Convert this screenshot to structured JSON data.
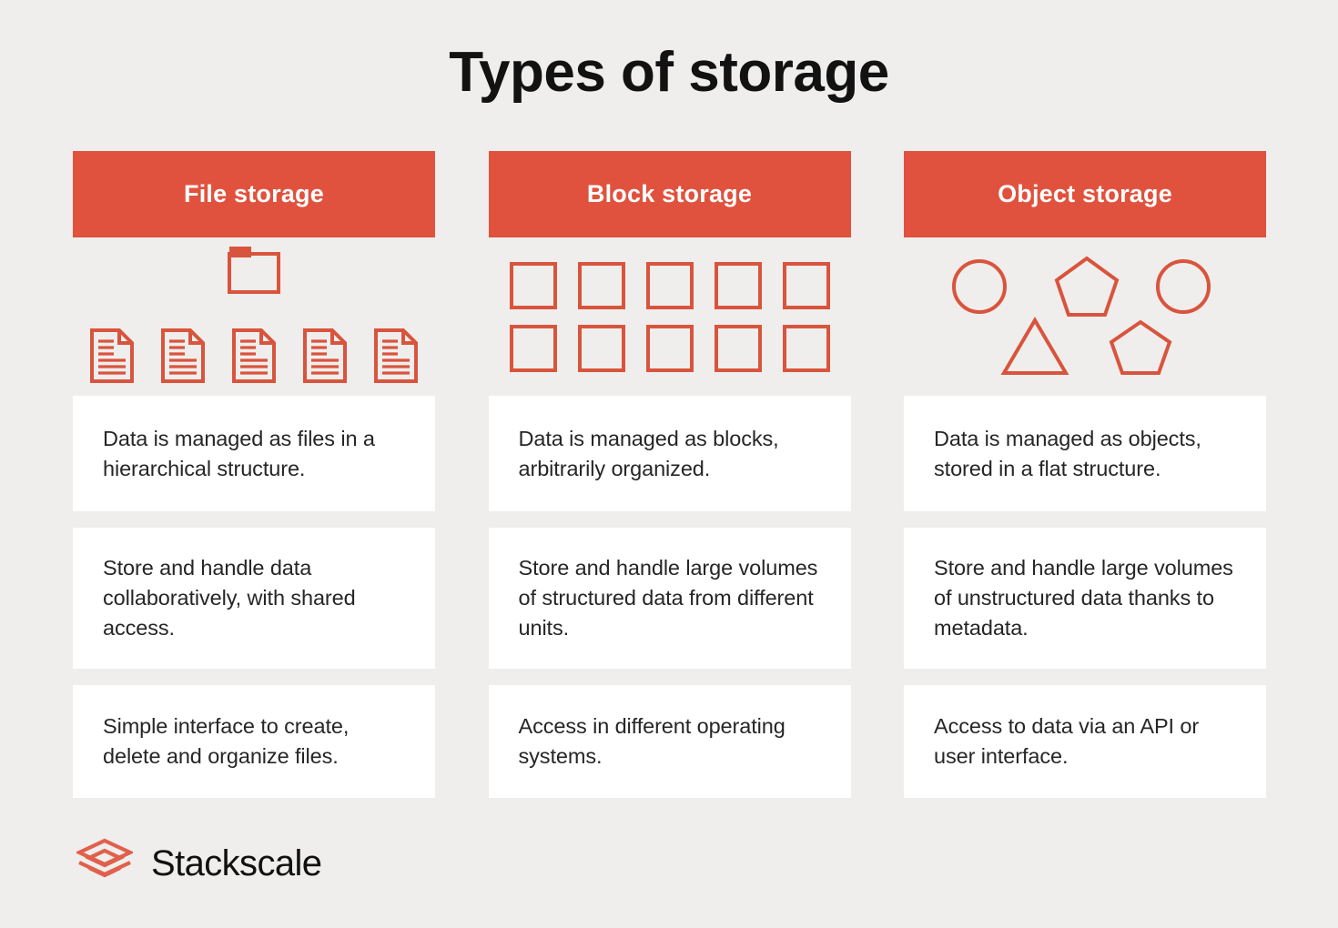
{
  "page": {
    "title": "Types of storage",
    "background_color": "#efeeec",
    "accent_color": "#e0523d",
    "card_color": "#ffffff",
    "text_color": "#262626"
  },
  "columns": [
    {
      "id": "file-storage",
      "header": "File storage",
      "icon_set": "folder-and-documents-icon",
      "icons": [
        "folder-icon",
        "document-icon",
        "document-icon",
        "document-icon",
        "document-icon",
        "document-icon"
      ],
      "cards": [
        "Data is managed as files in a hierarchical structure.",
        "Store and handle data collaboratively, with shared access.",
        "Simple interface to create, delete and organize files."
      ]
    },
    {
      "id": "block-storage",
      "header": "Block storage",
      "icon_set": "block-grid-icon",
      "icons": [
        "square-icon",
        "square-icon",
        "square-icon",
        "square-icon",
        "square-icon",
        "square-icon",
        "square-icon",
        "square-icon",
        "square-icon",
        "square-icon"
      ],
      "cards": [
        "Data is managed as blocks, arbitrarily organized.",
        "Store and handle large volumes of structured data from different units.",
        "Access in different operating systems."
      ]
    },
    {
      "id": "object-storage",
      "header": "Object storage",
      "icon_set": "mixed-shapes-icon",
      "icons": [
        "circle-icon",
        "pentagon-icon",
        "circle-icon",
        "triangle-icon",
        "pentagon-icon"
      ],
      "cards": [
        "Data is managed as objects, stored in a flat structure.",
        "Store and handle large volumes of unstructured data thanks to metadata.",
        "Access to data via an API or user interface."
      ]
    }
  ],
  "footer": {
    "logo_mark": "stackscale-layers-logo-icon",
    "brand": "Stackscale",
    "logo_color": "#e0604c"
  }
}
